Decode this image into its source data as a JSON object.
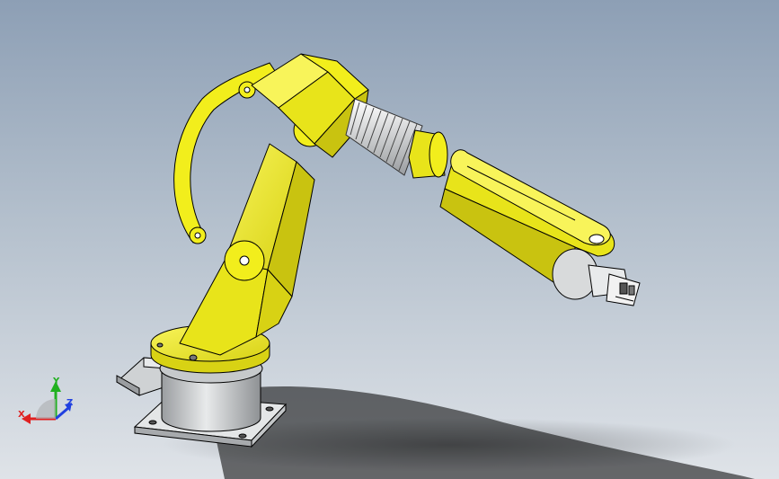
{
  "viewport": {
    "background_top": "#8d9fb5",
    "background_bottom": "#dfe3e8"
  },
  "model": {
    "colors": {
      "arm_yellow": "#f2ee1c",
      "arm_yellow_dark": "#c9c310",
      "steel": "#cfd2d4",
      "steel_dark": "#8e9194",
      "outline": "#000000"
    }
  },
  "triad": {
    "x_label": "X",
    "y_label": "Y",
    "z_label": "Z",
    "x_color": "#e02020",
    "y_color": "#20b020",
    "z_color": "#2040e0"
  }
}
